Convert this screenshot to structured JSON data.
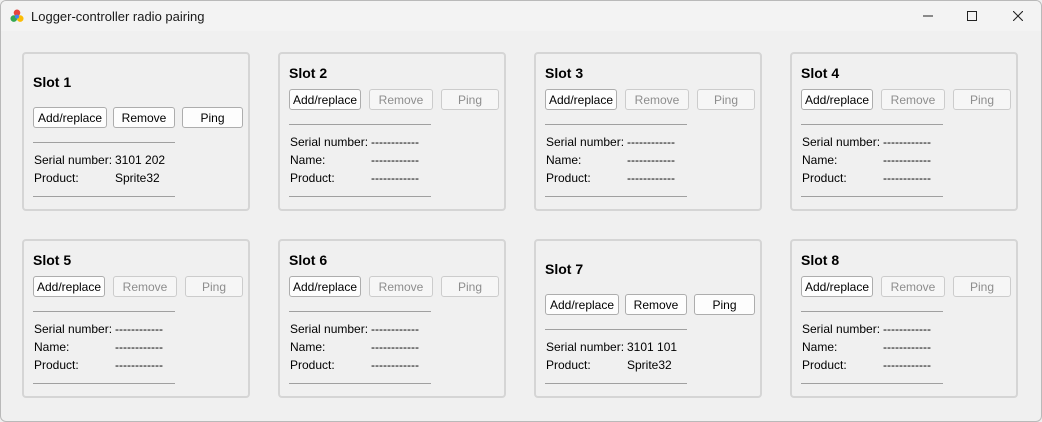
{
  "window": {
    "title": "Logger-controller radio pairing",
    "controls": {
      "minimize": "minimize-icon",
      "maximize": "maximize-icon",
      "close": "close-icon"
    }
  },
  "labels": {
    "add_replace": "Add/replace",
    "remove": "Remove",
    "ping": "Ping",
    "serial_number": "Serial number:",
    "name": "Name:",
    "product": "Product:"
  },
  "slots": [
    {
      "title": "Slot 1",
      "paired": true,
      "serial_number": "3101 202",
      "product": "Sprite32"
    },
    {
      "title": "Slot 2",
      "paired": false,
      "serial_number": "------------",
      "name": "------------",
      "product": "------------"
    },
    {
      "title": "Slot 3",
      "paired": false,
      "serial_number": "------------",
      "name": "------------",
      "product": "------------"
    },
    {
      "title": "Slot 4",
      "paired": false,
      "serial_number": "------------",
      "name": "------------",
      "product": "------------"
    },
    {
      "title": "Slot 5",
      "paired": false,
      "serial_number": "------------",
      "name": "------------",
      "product": "------------"
    },
    {
      "title": "Slot 6",
      "paired": false,
      "serial_number": "------------",
      "name": "------------",
      "product": "------------"
    },
    {
      "title": "Slot 7",
      "paired": true,
      "serial_number": "3101 101",
      "product": "Sprite32"
    },
    {
      "title": "Slot 8",
      "paired": false,
      "serial_number": "------------",
      "name": "------------",
      "product": "------------"
    }
  ]
}
